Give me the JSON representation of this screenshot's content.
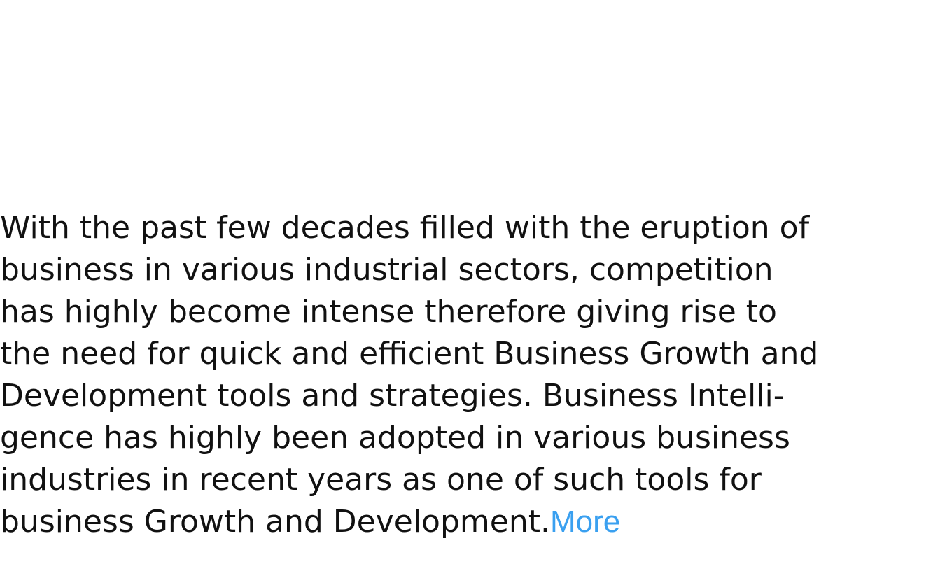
{
  "article": {
    "lines": [
      "With the past few decades filled with the eruption of",
      "business in various industrial sectors, competition",
      "has highly become intense therefore giving rise to",
      "the need for quick and efficient Business Growth and",
      "Development tools and strategies. Business Intelli-",
      "gence has highly been adopted in various business",
      "industries in recent years as one of such tools for",
      "business Growth and Development."
    ],
    "more_label": "More"
  },
  "colors": {
    "text": "#111111",
    "link": "#3aa0f0",
    "background": "#ffffff"
  }
}
